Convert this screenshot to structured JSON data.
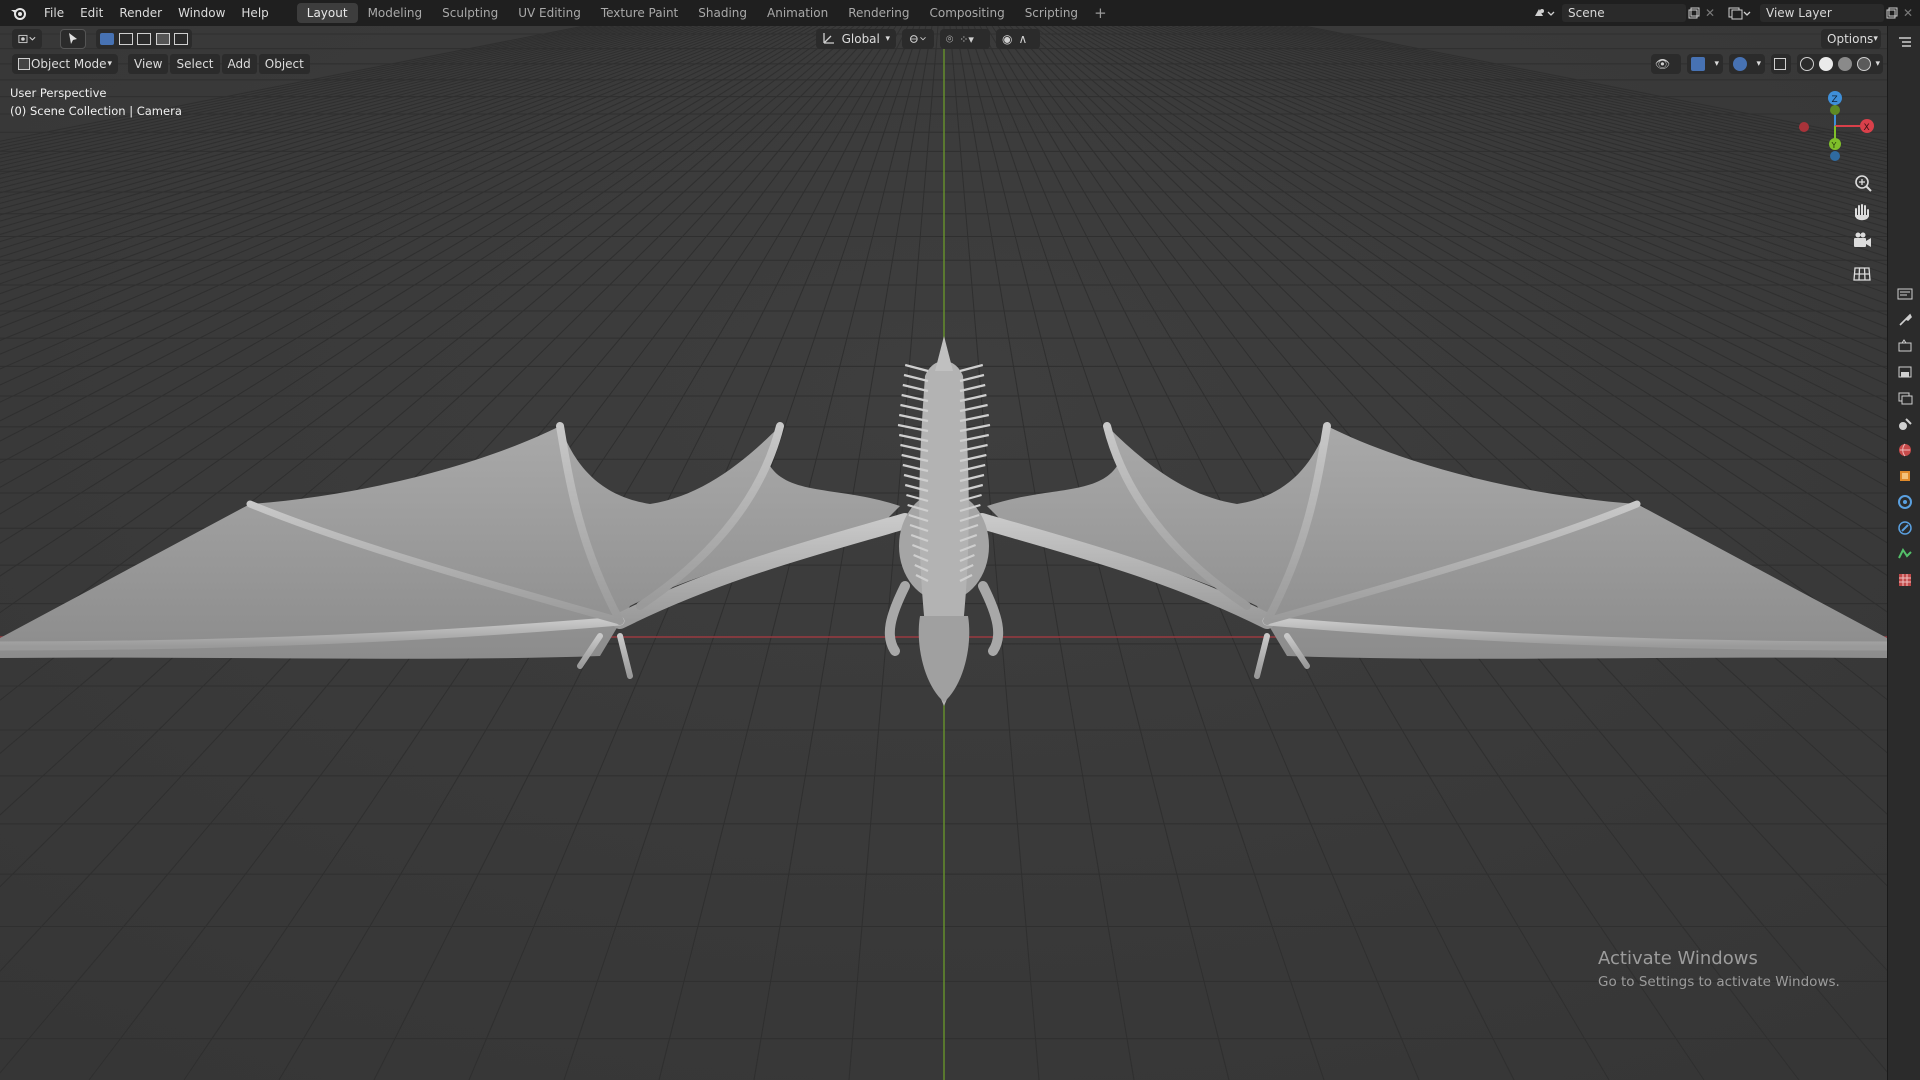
{
  "menu": [
    "File",
    "Edit",
    "Render",
    "Window",
    "Help"
  ],
  "workspaces": [
    "Layout",
    "Modeling",
    "Sculpting",
    "UV Editing",
    "Texture Paint",
    "Shading",
    "Animation",
    "Rendering",
    "Compositing",
    "Scripting"
  ],
  "active_workspace": "Layout",
  "scene": {
    "name": "Scene"
  },
  "view_layer": {
    "name": "View Layer"
  },
  "toolbar": {
    "transform_orientation": "Global",
    "options_label": "Options"
  },
  "viewport_header": {
    "mode": "Object Mode",
    "menus": [
      "View",
      "Select",
      "Add",
      "Object"
    ]
  },
  "viewport": {
    "perspective_label": "User Perspective",
    "collection_label": "(0) Scene Collection | Camera"
  },
  "gizmo": {
    "x": "X",
    "y": "Y",
    "z": "Z"
  },
  "colors": {
    "x_axis": "#d9404a",
    "y_axis": "#7fbf2a",
    "z_axis": "#3f8fd9",
    "accent": "#4772b3"
  },
  "watermark": {
    "title": "Activate Windows",
    "subtitle": "Go to Settings to activate Windows."
  }
}
